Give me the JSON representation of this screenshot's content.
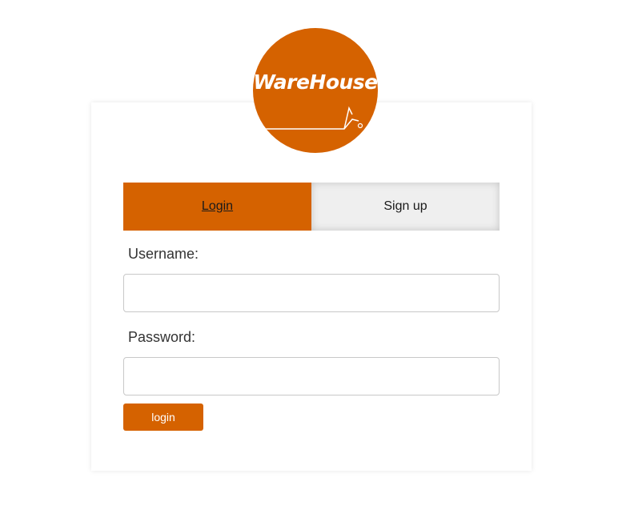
{
  "brand": {
    "name": "WareHouse",
    "accent_color": "#d56200"
  },
  "tabs": [
    {
      "label": "Login",
      "active": true
    },
    {
      "label": "Sign up",
      "active": false
    }
  ],
  "form": {
    "username_label": "Username:",
    "username_value": "",
    "username_placeholder": "",
    "password_label": "Password:",
    "password_value": "",
    "password_placeholder": "",
    "submit_label": "login"
  }
}
